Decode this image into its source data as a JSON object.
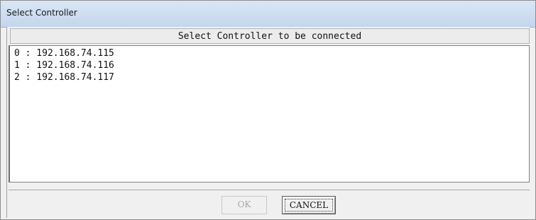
{
  "window": {
    "title": "Select Controller"
  },
  "header": {
    "text": "Select Controller to be connected"
  },
  "controllers": [
    "0 : 192.168.74.115",
    "1 : 192.168.74.116",
    "2 : 192.168.74.117"
  ],
  "buttons": {
    "ok_label": "OK",
    "ok_enabled": false,
    "cancel_label": "CANCEL"
  },
  "colors": {
    "titlebar": "#c4d6ec",
    "list_background": "#ffffff",
    "dialog_background": "#f0f0f0",
    "disabled_text": "#a8a8a8"
  }
}
